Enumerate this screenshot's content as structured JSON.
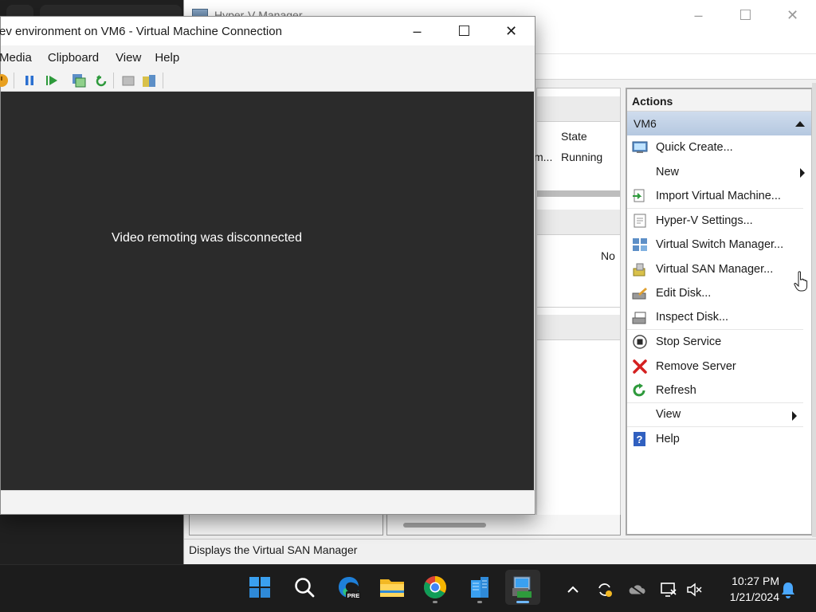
{
  "hyperv": {
    "title": "Hyper-V Manager",
    "status_text": "Displays the Virtual SAN Manager",
    "table": {
      "state_header": "State",
      "row_name_fragment": "m...",
      "row_state": "Running",
      "no_fragment": "No"
    },
    "actions": {
      "header": "Actions",
      "group": "VM6",
      "items": [
        {
          "label": "Quick Create...",
          "icon": "quick-create-icon"
        },
        {
          "label": "New",
          "icon": "",
          "submenu": true
        },
        {
          "label": "Import Virtual Machine...",
          "icon": "import-vm-icon"
        },
        {
          "label": "Hyper-V Settings...",
          "icon": "settings-icon"
        },
        {
          "label": "Virtual Switch Manager...",
          "icon": "switch-icon"
        },
        {
          "label": "Virtual SAN Manager...",
          "icon": "san-icon"
        },
        {
          "label": "Edit Disk...",
          "icon": "edit-disk-icon"
        },
        {
          "label": "Inspect Disk...",
          "icon": "inspect-disk-icon"
        },
        {
          "label": "Stop Service",
          "icon": "stop-icon"
        },
        {
          "label": "Remove Server",
          "icon": "remove-icon"
        },
        {
          "label": "Refresh",
          "icon": "refresh-icon"
        },
        {
          "label": "View",
          "icon": "",
          "submenu": true
        },
        {
          "label": "Help",
          "icon": "help-icon"
        }
      ]
    }
  },
  "vmconnection": {
    "title": "ev environment on VM6 - Virtual Machine Connection",
    "menu": [
      "Media",
      "Clipboard",
      "View",
      "Help"
    ],
    "message": "Video remoting was disconnected"
  },
  "taskbar": {
    "time": "10:27 PM",
    "date": "1/21/2024",
    "apps": [
      "start-icon",
      "search-icon",
      "edge-preview-icon",
      "file-explorer-icon",
      "chrome-icon",
      "server-manager-icon",
      "hyperv-manager-icon"
    ],
    "edge_badge": "PRE"
  },
  "colors": {
    "vm_screen": "#2b2b2b",
    "actions_group": "#c3d3e8",
    "taskbar": "#1c1c1c"
  }
}
